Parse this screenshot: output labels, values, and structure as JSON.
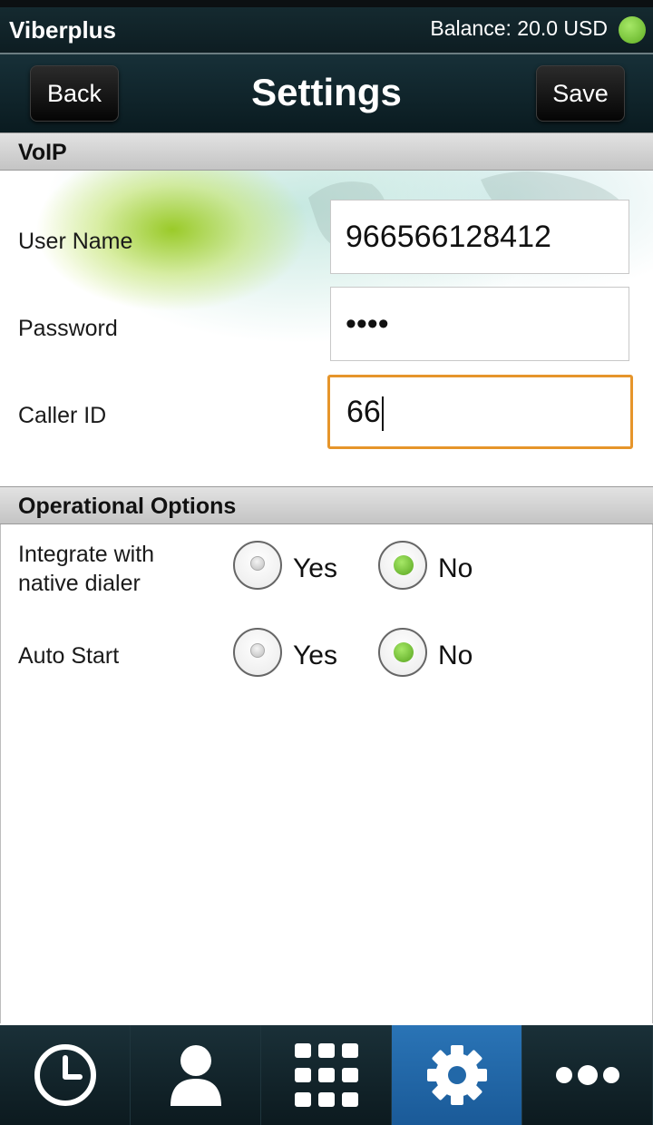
{
  "app": {
    "name": "Viberplus",
    "balance": "Balance: 20.0 USD",
    "status_color": "#7ccf3a"
  },
  "header": {
    "title": "Settings",
    "back_label": "Back",
    "save_label": "Save"
  },
  "voip": {
    "section_title": "VoIP",
    "username": {
      "label": "User Name",
      "value": "966566128412"
    },
    "password": {
      "label": "Password",
      "value": "••••"
    },
    "caller_id": {
      "label": "Caller ID",
      "value": "66"
    }
  },
  "operational": {
    "section_title": "Operational Options",
    "options": [
      {
        "label_line1": "Integrate with",
        "label_line2": "native dialer",
        "yes": "Yes",
        "no": "No",
        "selected": "No"
      },
      {
        "label_line1": "Auto Start",
        "yes": "Yes",
        "no": "No",
        "selected": "No"
      }
    ]
  },
  "tabbar": {
    "active_color": "#2a74b6",
    "tabs": [
      {
        "icon": "clock-icon",
        "active": false
      },
      {
        "icon": "contact-person-icon",
        "active": false
      },
      {
        "icon": "dialpad-icon",
        "active": false
      },
      {
        "icon": "gear-icon",
        "active": true
      },
      {
        "icon": "more-dots-icon",
        "active": false
      }
    ]
  }
}
